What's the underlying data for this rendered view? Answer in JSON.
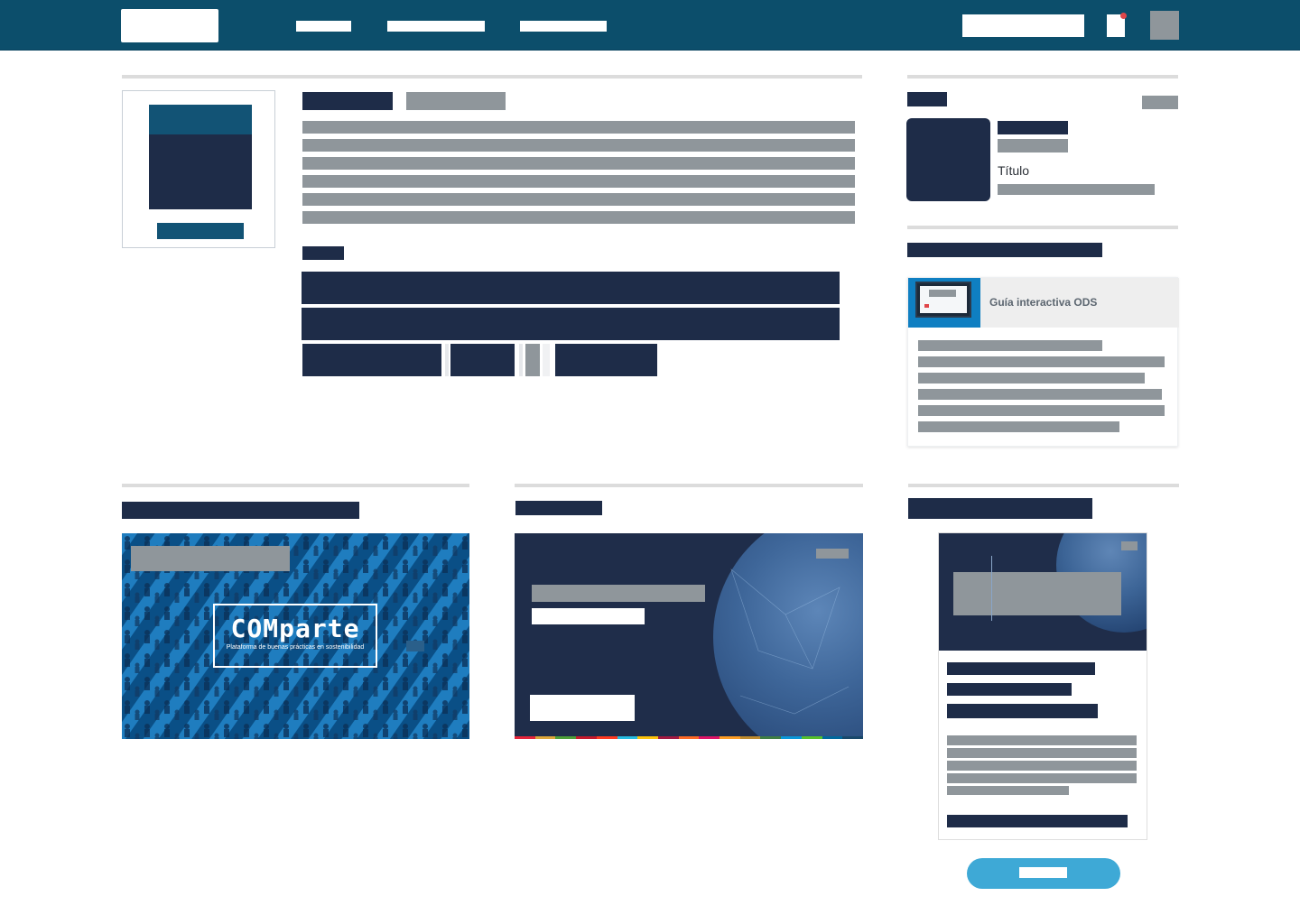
{
  "header": {
    "background": "#0c4e6b",
    "icons": [
      "logo",
      "search-icon",
      "notification-icon",
      "avatar"
    ]
  },
  "sidebar_author": {
    "role_label": "Título"
  },
  "guide": {
    "title": "Guía interactiva ODS"
  },
  "banner_comparte": {
    "logo_word": "COMparte",
    "logo_subtitle": "Plataforma de buenas prácticas en sostenibilidad"
  },
  "colors": {
    "navy": "#1e2c48",
    "header_blue": "#0c4e6b",
    "accent": "#3ea9d6",
    "placeholder_grey": "#8f969b"
  }
}
